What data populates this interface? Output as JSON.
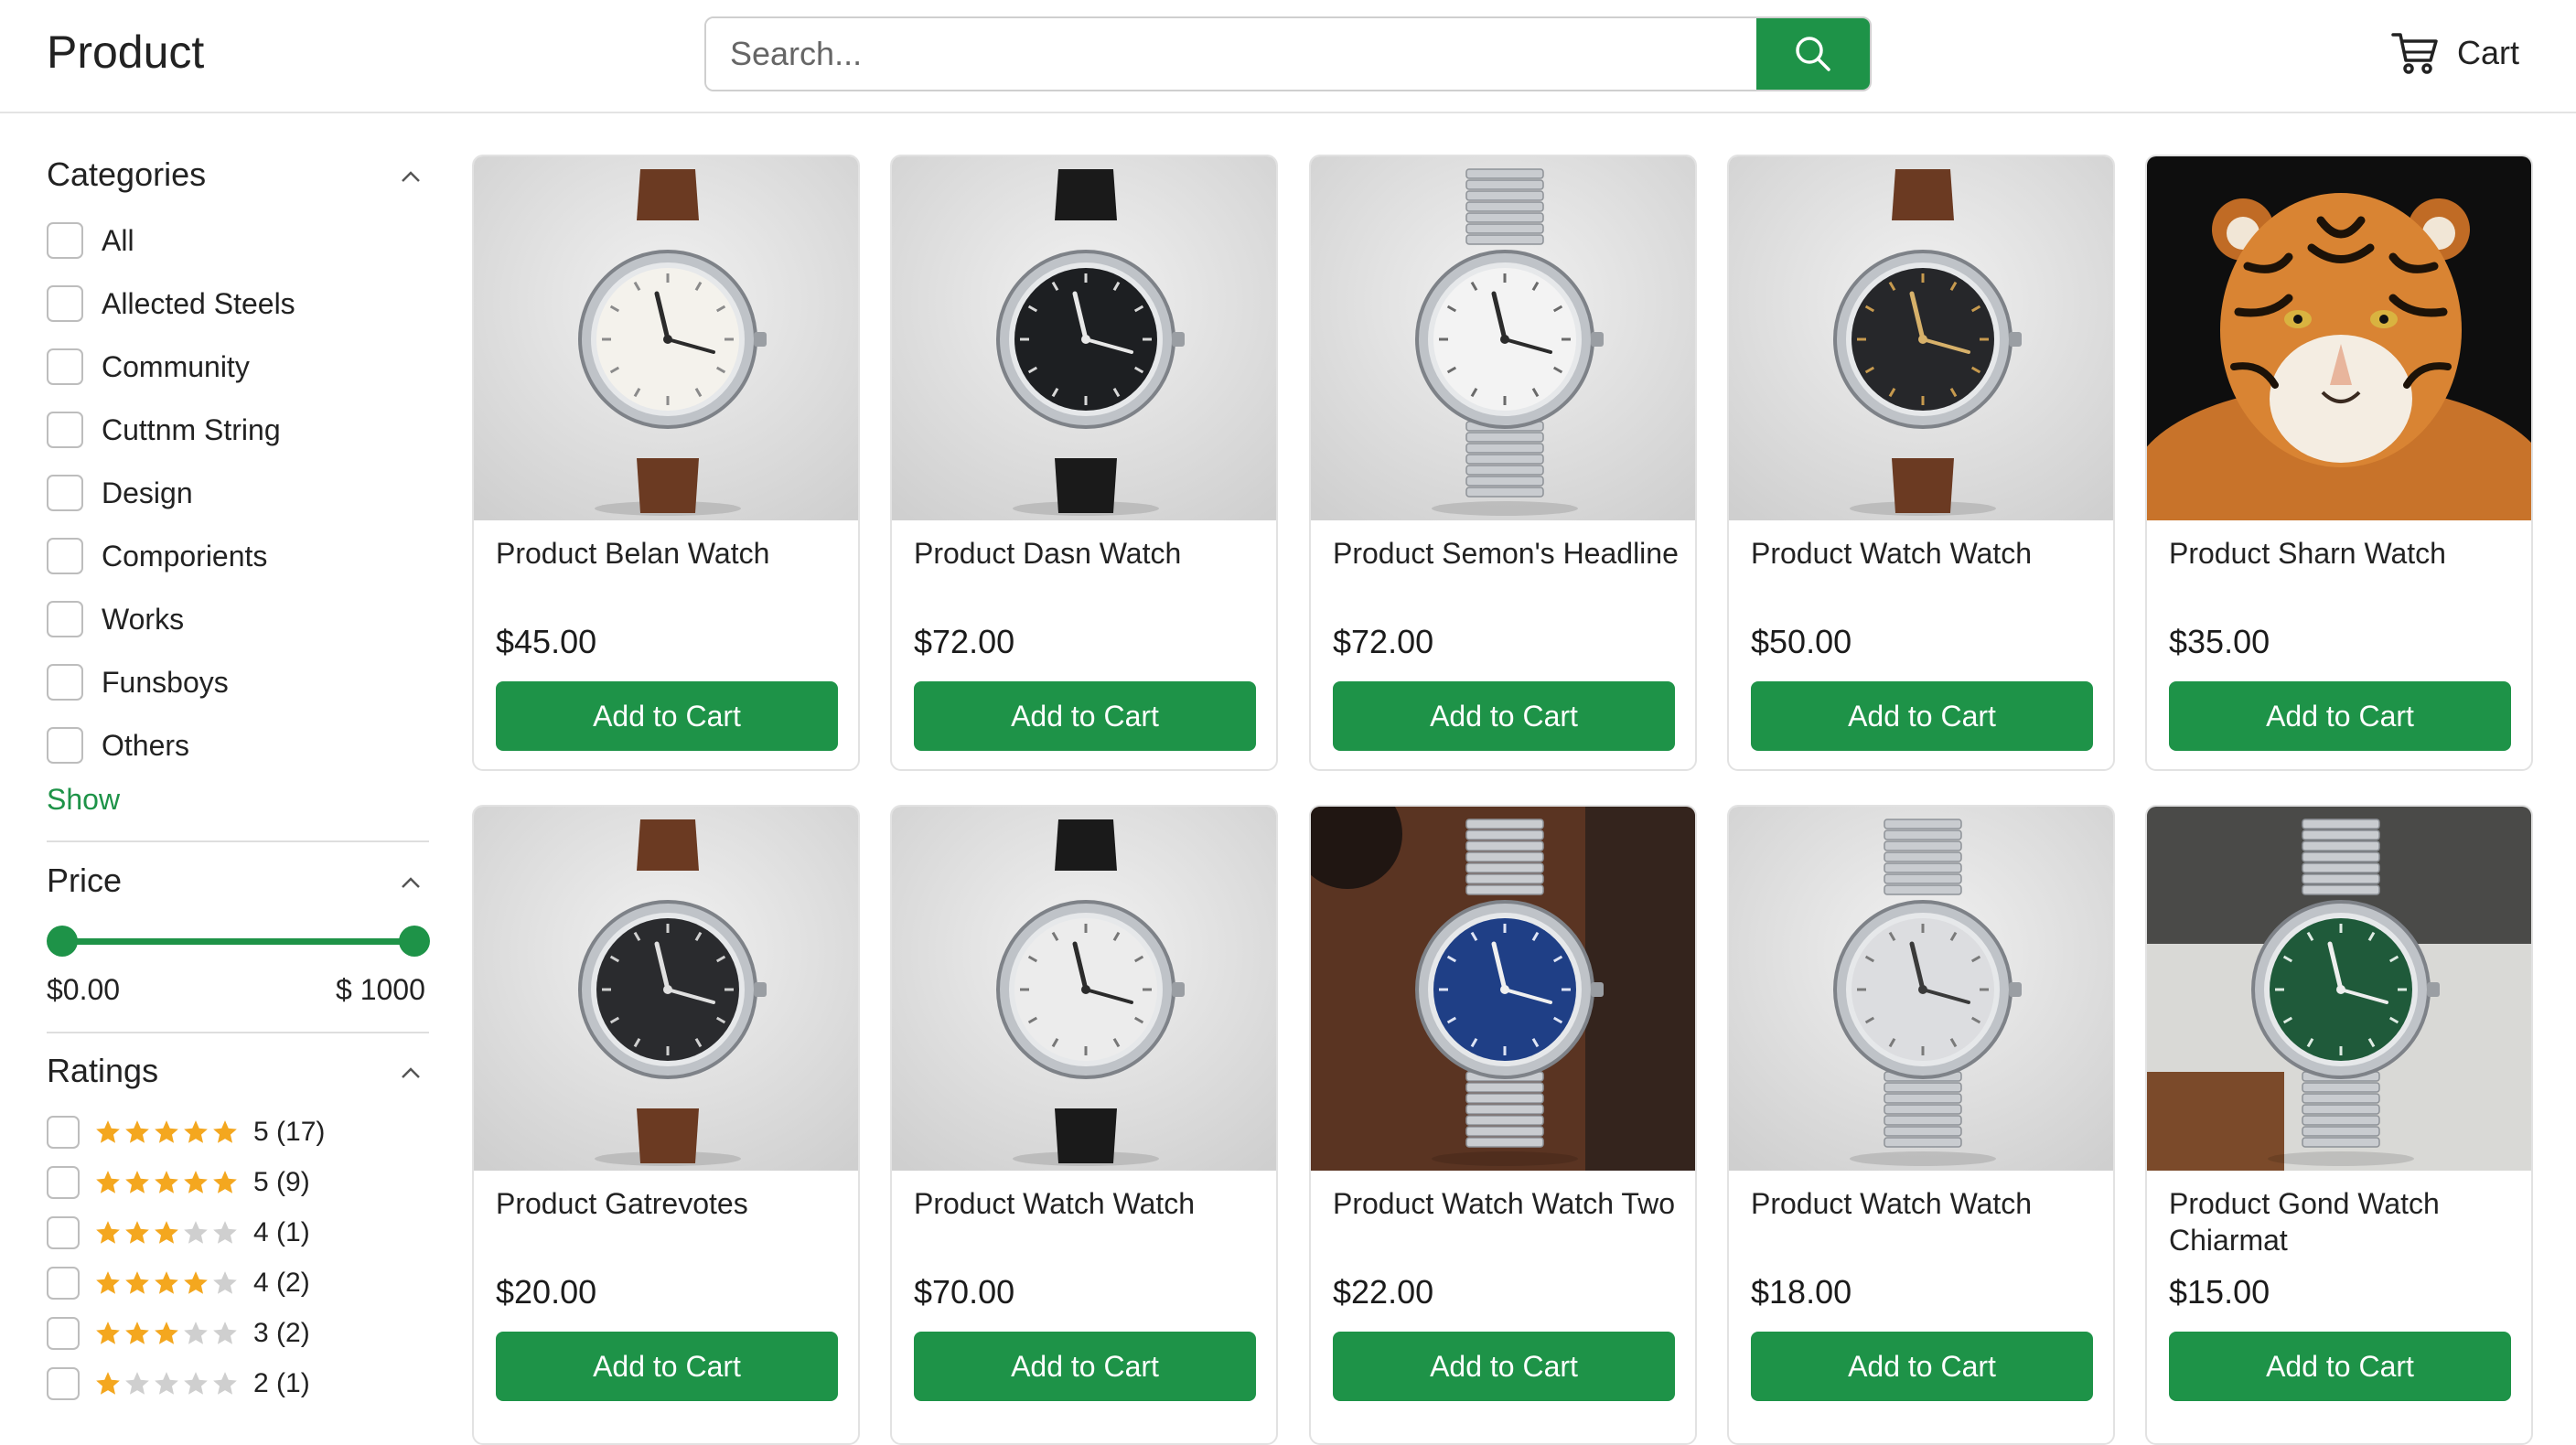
{
  "header": {
    "title": "Product",
    "search_placeholder": "Search...",
    "cart_label": "Cart"
  },
  "sidebar": {
    "categories_title": "Categories",
    "categories": [
      "All",
      "Allected Steels",
      "Community",
      "Cuttnm String",
      "Design",
      "Comporients",
      "Works",
      "Funsboys",
      "Others"
    ],
    "show_label": "Show",
    "price_title": "Price",
    "price_min": "$0.00",
    "price_max": "$ 1000",
    "price_range_fraction": [
      0.0,
      1.0
    ],
    "ratings_title": "Ratings",
    "ratings": [
      {
        "stars": 5,
        "label": "5 (17)"
      },
      {
        "stars": 5,
        "label": "5 (9)"
      },
      {
        "stars": 3,
        "label": "4 (1)"
      },
      {
        "stars": 4,
        "label": "4 (2)"
      },
      {
        "stars": 3,
        "label": "3 (2)"
      },
      {
        "stars": 1,
        "label": "2 (1)"
      }
    ]
  },
  "products": [
    {
      "name": "Product Belan Watch",
      "price": "$45.00",
      "button": "Add to Cart",
      "image": "watch-brown-strap-white-dial"
    },
    {
      "name": "Product Dasn Watch",
      "price": "$72.00",
      "button": "Add to Cart",
      "image": "watch-black-strap-black-dial"
    },
    {
      "name": "Product Semon's Headline",
      "price": "$72.00",
      "button": "Add to Cart",
      "image": "watch-steel-bracelet-white-dial"
    },
    {
      "name": "Product Watch Watch",
      "price": "$50.00",
      "button": "Add to Cart",
      "image": "watch-brown-strap-chronograph"
    },
    {
      "name": "Product Sharn Watch",
      "price": "$35.00",
      "button": "Add to Cart",
      "image": "tiger-photo"
    },
    {
      "name": "Product Gatrevotes",
      "price": "$20.00",
      "button": "Add to Cart",
      "image": "watch-brown-strap-black-dial"
    },
    {
      "name": "Product Watch Watch",
      "price": "$70.00",
      "button": "Add to Cart",
      "image": "watch-black-strap-white-dial"
    },
    {
      "name": "Product Watch Watch Two",
      "price": "$22.00",
      "button": "Add to Cart",
      "image": "watch-steel-bracelet-blue-dial"
    },
    {
      "name": "Product Watch Watch",
      "price": "$18.00",
      "button": "Add to Cart",
      "image": "watch-steel-bracelet-silver-dial"
    },
    {
      "name": "Product Gond Watch Chiarmat",
      "price": "$15.00",
      "button": "Add to Cart",
      "image": "watch-steel-bracelet-green-dial"
    }
  ],
  "colors": {
    "accent": "#1e9348",
    "star": "#f4a71f",
    "star_empty": "#cfcfcf"
  }
}
